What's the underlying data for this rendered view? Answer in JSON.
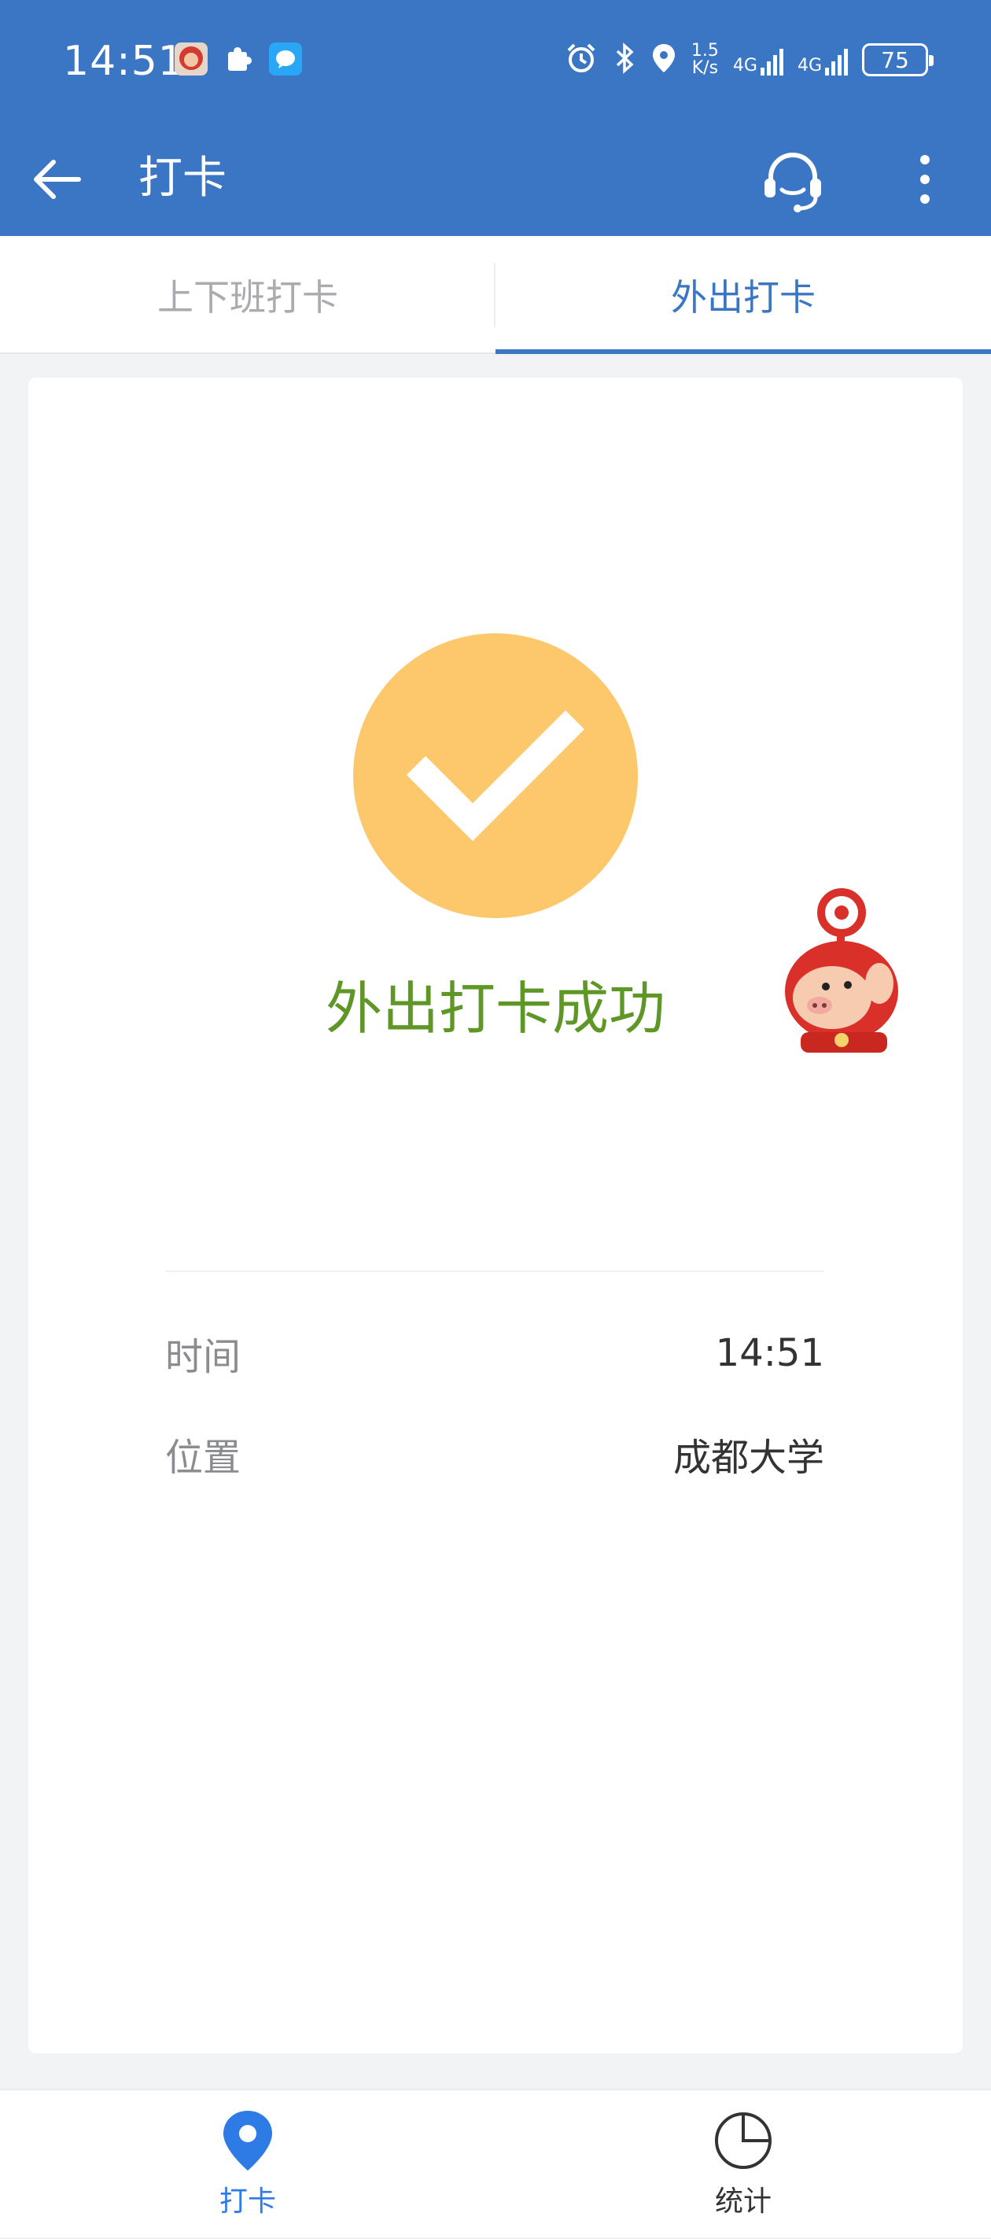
{
  "status_bar": {
    "time": "14:51",
    "speed_top": "1.5",
    "speed_bottom": "K/s",
    "net1": "4G",
    "net2": "4G",
    "battery": "75"
  },
  "app_bar": {
    "title": "打卡",
    "back_icon": "arrow-left-icon",
    "support_icon": "headset-icon",
    "more_icon": "more-vertical-icon"
  },
  "tabs": [
    {
      "label": "上下班打卡",
      "selected": false
    },
    {
      "label": "外出打卡",
      "selected": true
    }
  ],
  "result": {
    "message": "外出打卡成功",
    "icon": "check-circle-icon",
    "icon_color": "#fdc76b",
    "message_color": "#5f9727"
  },
  "details": [
    {
      "label": "时间",
      "value": "14:51"
    },
    {
      "label": "位置",
      "value": "成都大学"
    }
  ],
  "bottom_nav": [
    {
      "label": "打卡",
      "icon": "location-pin-icon",
      "active": true
    },
    {
      "label": "统计",
      "icon": "pie-chart-icon",
      "active": false
    }
  ],
  "colors": {
    "primary": "#3a76c4",
    "nav_active": "#2f7be6"
  }
}
